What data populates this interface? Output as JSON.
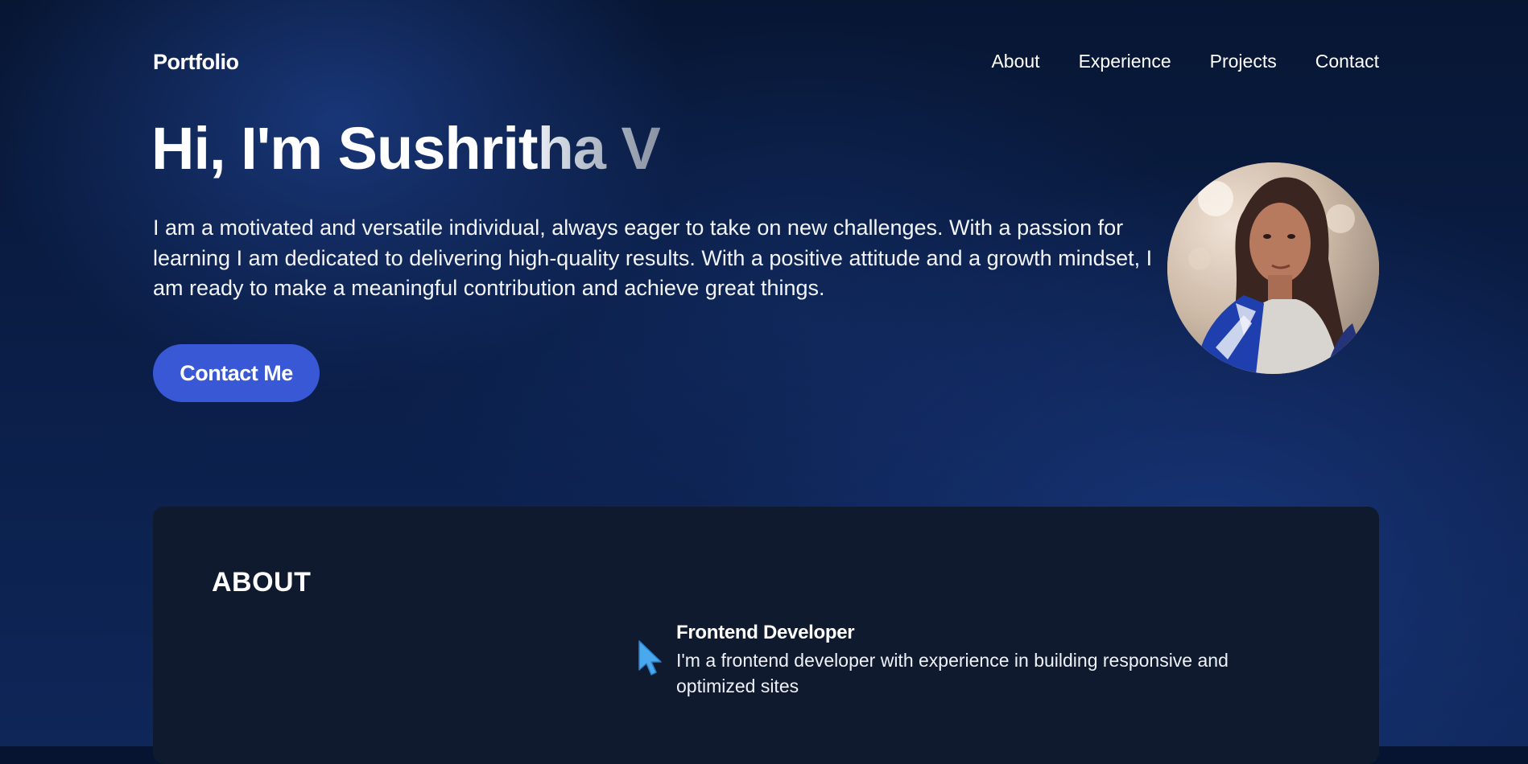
{
  "header": {
    "logo": "Portfolio",
    "nav": [
      {
        "label": "About"
      },
      {
        "label": "Experience"
      },
      {
        "label": "Projects"
      },
      {
        "label": "Contact"
      }
    ]
  },
  "hero": {
    "title_solid": "Hi, I'm Sushrit",
    "title_fade": "ha V",
    "description": "I am a motivated and versatile individual, always eager to take on new challenges. With a passion for learning I am dedicated to delivering high-quality results. With a positive attitude and a growth mindset, I am ready to make a meaningful contribution and achieve great things.",
    "cta_label": "Contact Me"
  },
  "about": {
    "heading": "ABOUT",
    "items": [
      {
        "title": "Frontend Developer",
        "text": "I'm a frontend developer with experience in building responsive and optimized sites",
        "icon": "cursor-icon"
      }
    ]
  },
  "colors": {
    "background": "#061431",
    "accent": "#3858d6",
    "card": "#101a2e",
    "cursor_icon": "#4aa8ee"
  }
}
